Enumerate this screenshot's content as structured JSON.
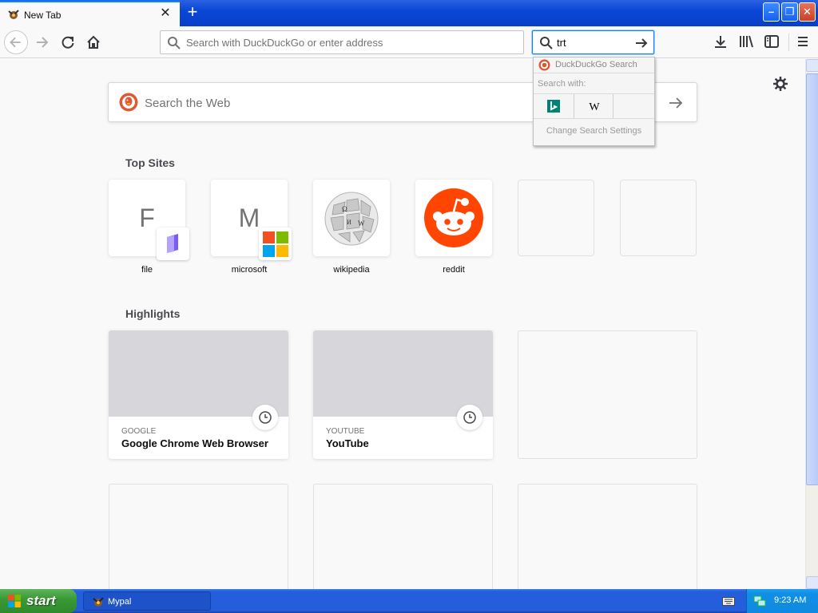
{
  "tab": {
    "title": "New Tab"
  },
  "urlbar": {
    "placeholder": "Search with DuckDuckGo or enter address"
  },
  "searchbar": {
    "value": "trt"
  },
  "search_popup": {
    "engine_name": "DuckDuckGo Search",
    "search_with": "Search with:",
    "alt_engines": [
      "bing",
      "wikipedia"
    ],
    "change_settings": "Change Search Settings"
  },
  "web_search": {
    "placeholder": "Search the Web"
  },
  "top_sites": {
    "title": "Top Sites",
    "items": [
      {
        "letter": "F",
        "label": "file"
      },
      {
        "letter": "M",
        "label": "microsoft"
      },
      {
        "letter": "",
        "label": "wikipedia"
      },
      {
        "letter": "",
        "label": "reddit"
      }
    ]
  },
  "highlights": {
    "title": "Highlights",
    "items": [
      {
        "source": "GOOGLE",
        "title": "Google Chrome Web Browser"
      },
      {
        "source": "YOUTUBE",
        "title": "YouTube"
      }
    ]
  },
  "taskbar": {
    "start": "start",
    "window": "Mypal",
    "clock": "9:23 AM"
  },
  "colors": {
    "accent": "#0a84ff",
    "reddit": "#ff4500",
    "taskbar": "#245edb"
  }
}
